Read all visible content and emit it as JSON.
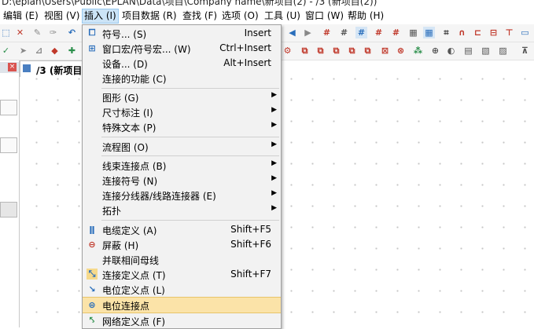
{
  "window": {
    "title": "D:\\eplan\\Users\\Public\\EPLAN\\Data\\项目\\Company name\\新项目(2) - /3 (新项目(2))"
  },
  "menubar": {
    "items": [
      {
        "label": "编辑 (E)"
      },
      {
        "label": "视图 (V)"
      },
      {
        "label": "插入 (I)"
      },
      {
        "label": "项目数据 (R)"
      },
      {
        "label": "查找 (F)"
      },
      {
        "label": "选项 (O)"
      },
      {
        "label": "工具 (U)"
      },
      {
        "label": "窗口 (W)"
      },
      {
        "label": "帮助 (H)"
      }
    ]
  },
  "document_tab": {
    "label": "/3 (新项目"
  },
  "insert_menu": {
    "items": [
      {
        "label": "符号... (S)",
        "shortcut": "Insert",
        "icon": "symbol-icon"
      },
      {
        "label": "窗口宏/符号宏... (W)",
        "shortcut": "Ctrl+Insert",
        "icon": "macro-icon"
      },
      {
        "label": "设备... (D)",
        "shortcut": "Alt+Insert"
      },
      {
        "label": "连接的功能 (C)"
      },
      {
        "label": "图形 (G)",
        "submenu": true
      },
      {
        "label": "尺寸标注 (I)",
        "submenu": true
      },
      {
        "label": "特殊文本 (P)",
        "submenu": true
      },
      {
        "label": "流程图 (O)",
        "submenu": true
      },
      {
        "label": "线束连接点 (B)",
        "submenu": true
      },
      {
        "label": "连接符号 (N)",
        "submenu": true
      },
      {
        "label": "连接分线器/线路连接器 (E)",
        "submenu": true
      },
      {
        "label": "拓扑",
        "submenu": true
      },
      {
        "label": "电缆定义 (A)",
        "shortcut": "Shift+F5",
        "icon": "cable-definition-icon"
      },
      {
        "label": "屏蔽 (H)",
        "shortcut": "Shift+F6",
        "icon": "shield-icon"
      },
      {
        "label": "并联相间母线"
      },
      {
        "label": "连接定义点 (T)",
        "shortcut": "Shift+F7",
        "icon": "connection-definition-point-icon"
      },
      {
        "label": "电位定义点 (L)",
        "icon": "potential-definition-point-icon"
      },
      {
        "label": "电位连接点",
        "icon": "potential-connection-point-icon",
        "highlighted": true
      },
      {
        "label": "网络定义点 (F)",
        "icon": "network-definition-point-icon"
      }
    ]
  },
  "toolbar_glyphs": {
    "row1_right": [
      "#A",
      "#B",
      "#C",
      "#D",
      "#E"
    ]
  },
  "colors": {
    "menu_highlight": "#fbe3a8",
    "menubar_active": "#cce4f7",
    "menu_bg": "#f2f2f2"
  }
}
